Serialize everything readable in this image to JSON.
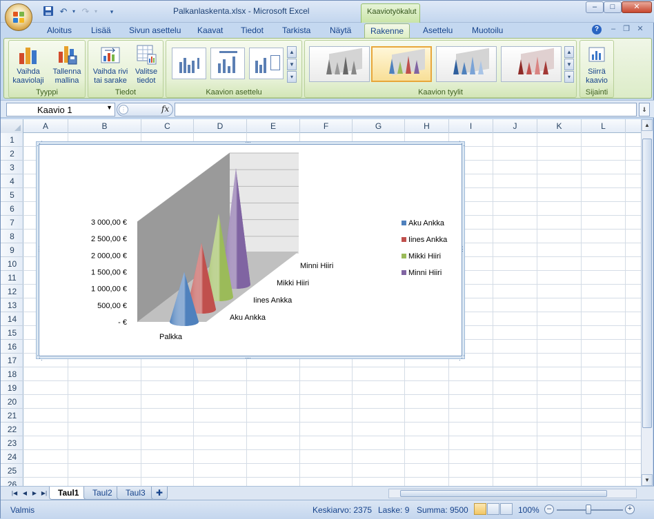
{
  "window": {
    "title": "Palkanlaskenta.xlsx - Microsoft Excel",
    "context_tab_title": "Kaaviotyökalut",
    "controls": {
      "minimize": "–",
      "maximize": "□",
      "close": "✕"
    }
  },
  "ribbon": {
    "tabs": [
      "Aloitus",
      "Lisää",
      "Sivun asettelu",
      "Kaavat",
      "Tiedot",
      "Tarkista",
      "Näytä",
      "Rakenne",
      "Asettelu",
      "Muotoilu"
    ],
    "active_tab": "Rakenne",
    "groups": {
      "tyyppi": {
        "label": "Tyyppi",
        "buttons": [
          {
            "line1": "Vaihda",
            "line2": "kaaviolaji"
          },
          {
            "line1": "Tallenna",
            "line2": "mallina"
          }
        ]
      },
      "tiedot": {
        "label": "Tiedot",
        "buttons": [
          {
            "line1": "Vaihda rivi",
            "line2": "tai sarake"
          },
          {
            "line1": "Valitse",
            "line2": "tiedot"
          }
        ]
      },
      "asettelu": {
        "label": "Kaavion asettelu"
      },
      "tyylit": {
        "label": "Kaavion tyylit"
      },
      "sijainti": {
        "label": "Sijainti",
        "buttons": [
          {
            "line1": "Siirrä",
            "line2": "kaavio"
          }
        ]
      }
    }
  },
  "formula_bar": {
    "name_box": "Kaavio 1",
    "fx": "fx",
    "value": ""
  },
  "sheet": {
    "columns": [
      "A",
      "B",
      "C",
      "D",
      "E",
      "F",
      "G",
      "H",
      "I",
      "J",
      "K",
      "L"
    ],
    "rows": [
      "1",
      "2",
      "3",
      "4",
      "5",
      "6",
      "7",
      "8",
      "9",
      "10",
      "11",
      "12",
      "13",
      "14",
      "15",
      "16",
      "17",
      "18",
      "19",
      "20",
      "21",
      "22",
      "23",
      "24",
      "25",
      "26"
    ]
  },
  "chart_data": {
    "type": "bar",
    "variant": "3d-cone",
    "categories": [
      "Palkka"
    ],
    "series": [
      {
        "name": "Aku Ankka",
        "values": [
          1500
        ],
        "color": "#4f81bd"
      },
      {
        "name": "Iines Ankka",
        "values": [
          2000
        ],
        "color": "#c0504d"
      },
      {
        "name": "Mikki Hiiri",
        "values": [
          2500
        ],
        "color": "#9bbb59"
      },
      {
        "name": "Minni Hiiri",
        "values": [
          3500
        ],
        "color": "#8064a2"
      }
    ],
    "depth_labels": [
      "Aku Ankka",
      "Iines Ankka",
      "Mikki Hiiri",
      "Minni Hiiri"
    ],
    "y_ticks": [
      "-  €",
      "500,00 €",
      "1 000,00 €",
      "1 500,00 €",
      "2 000,00 €",
      "2 500,00 €",
      "3 000,00 €"
    ],
    "ylim": [
      0,
      3000
    ],
    "legend_position": "right",
    "grid": true,
    "title": "",
    "xlabel": "",
    "ylabel": ""
  },
  "sheet_tabs": [
    "Taul1",
    "Taul2",
    "Taul3"
  ],
  "active_sheet": "Taul1",
  "status": {
    "mode": "Valmis",
    "average": "Keskiarvo: 2375",
    "count": "Laske: 9",
    "sum": "Summa: 9500",
    "zoom": "100%"
  }
}
